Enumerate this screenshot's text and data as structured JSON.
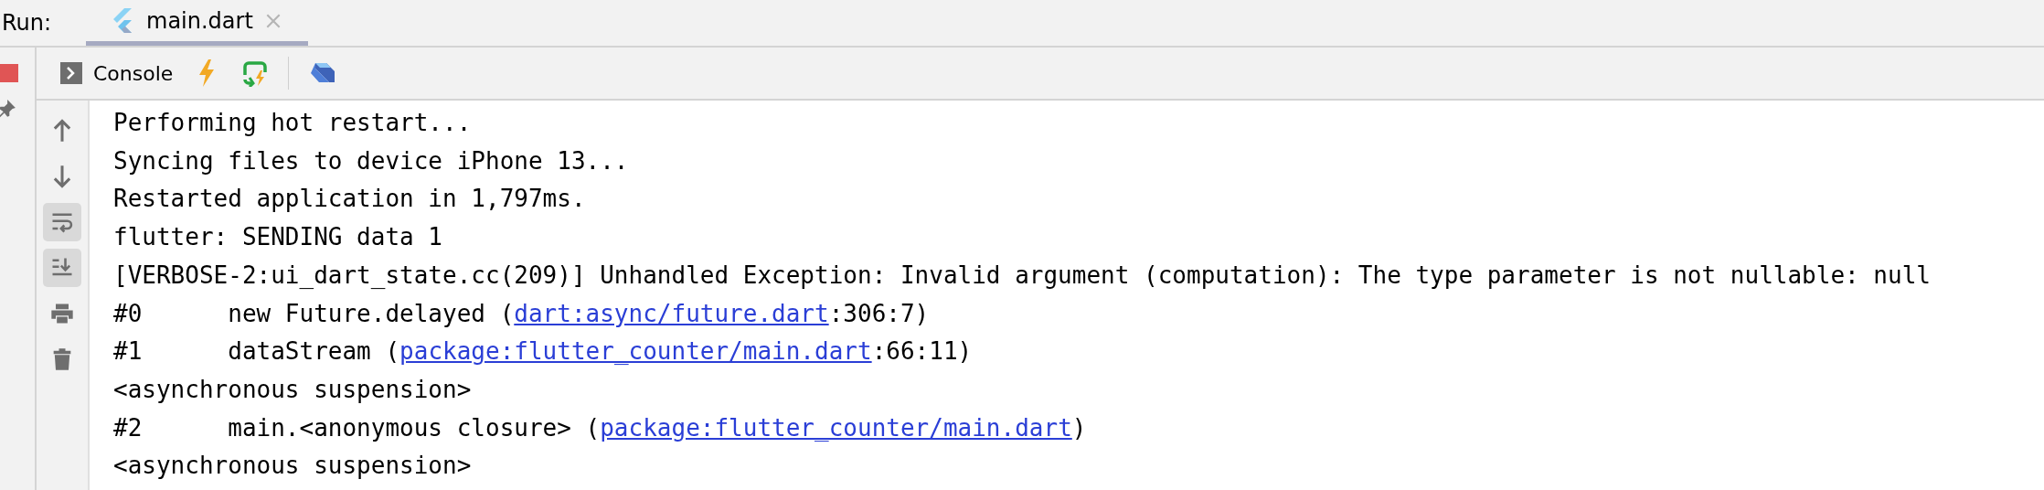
{
  "run_label": "Run:",
  "tabs": [
    {
      "label": "main.dart",
      "selected": true
    }
  ],
  "toolbar": {
    "console_label": "Console"
  },
  "gutter": [
    {
      "kind": "up",
      "selected": false
    },
    {
      "kind": "down",
      "selected": false
    },
    {
      "kind": "wrap",
      "selected": true
    },
    {
      "kind": "scroll",
      "selected": true
    },
    {
      "kind": "print",
      "selected": false
    },
    {
      "kind": "trash",
      "selected": false
    }
  ],
  "console": [
    {
      "parts": [
        {
          "text": "Performing hot restart...",
          "kind": "text"
        }
      ]
    },
    {
      "parts": [
        {
          "text": "Syncing files to device iPhone 13...",
          "kind": "text"
        }
      ]
    },
    {
      "parts": [
        {
          "text": "Restarted application in 1,797ms.",
          "kind": "text"
        }
      ]
    },
    {
      "parts": [
        {
          "text": "flutter: SENDING data 1",
          "kind": "text"
        }
      ]
    },
    {
      "parts": [
        {
          "text": "[VERBOSE-2:ui_dart_state.cc(209)] Unhandled Exception: Invalid argument (computation): The type parameter is not nullable: null",
          "kind": "text"
        }
      ]
    },
    {
      "parts": [
        {
          "text": "#0      new Future.delayed (",
          "kind": "text"
        },
        {
          "text": "dart:async/future.dart",
          "kind": "link"
        },
        {
          "text": ":306:7)",
          "kind": "text"
        }
      ]
    },
    {
      "parts": [
        {
          "text": "#1      dataStream (",
          "kind": "text"
        },
        {
          "text": "package:flutter_counter/main.dart",
          "kind": "link"
        },
        {
          "text": ":66:11)",
          "kind": "text"
        }
      ]
    },
    {
      "parts": [
        {
          "text": "<asynchronous suspension>",
          "kind": "text"
        }
      ]
    },
    {
      "parts": [
        {
          "text": "#2      main.<anonymous closure> (",
          "kind": "text"
        },
        {
          "text": "package:flutter_counter/main.dart",
          "kind": "link"
        },
        {
          "text": ")",
          "kind": "text"
        }
      ]
    },
    {
      "parts": [
        {
          "text": "<asynchronous suspension>",
          "kind": "text"
        }
      ]
    }
  ]
}
